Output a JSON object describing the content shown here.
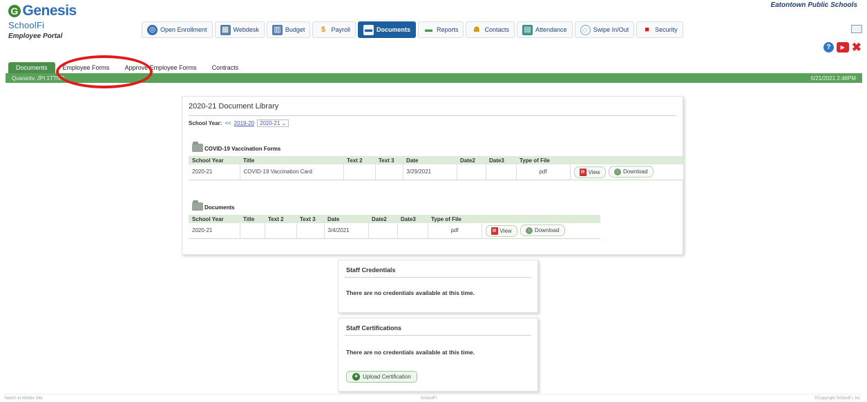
{
  "header": {
    "brand": "Genesis",
    "brand_mark": "G",
    "product": "SchoolFi",
    "portal": "Employee Portal",
    "district": "Eatontown Public Schools"
  },
  "nav": [
    {
      "label": "Open Enrollment",
      "icon": "enrollment-icon",
      "active": false
    },
    {
      "label": "Webdesk",
      "icon": "webdesk-icon",
      "active": false
    },
    {
      "label": "Budget",
      "icon": "budget-icon",
      "active": false
    },
    {
      "label": "Payroll",
      "icon": "dollar-icon",
      "active": false
    },
    {
      "label": "Documents",
      "icon": "folder-icon",
      "active": true
    },
    {
      "label": "Reports",
      "icon": "folder-icon",
      "active": false
    },
    {
      "label": "Contacts",
      "icon": "contacts-icon",
      "active": false
    },
    {
      "label": "Attendance",
      "icon": "calendar-icon",
      "active": false
    },
    {
      "label": "Swipe In/Out",
      "icon": "swipe-icon",
      "active": false
    },
    {
      "label": "Security",
      "icon": "lock-icon",
      "active": false
    }
  ],
  "tabs": [
    "Documents",
    "Employee Forms",
    "Approve Employee Forms",
    "Contracts"
  ],
  "status_bar": {
    "user": "Quarantv, JPI 1TTNG",
    "datetime": "5/21/2021 2:48PM"
  },
  "library": {
    "title": "2020-21 Document Library",
    "year_label": "School Year:",
    "year_prev_marker": "<<",
    "year_prev": "2019-20",
    "year_selected": "2020-21",
    "sections": [
      {
        "title": "COVID-19 Vaccination Forms",
        "headers": [
          "School Year",
          "Title",
          "Text 2",
          "Text 3",
          "Date",
          "Date2",
          "Date3",
          "Type of File",
          ""
        ],
        "rows": [
          {
            "school_year": "2020-21",
            "title": "COVID-19 Vaccination Card",
            "text2": "",
            "text3": "",
            "date": "3/29/2021",
            "date2": "",
            "date3": "",
            "type": "pdf"
          }
        ]
      },
      {
        "title": "Documents",
        "headers": [
          "School Year",
          "Title",
          "Text 2",
          "Text 3",
          "Date",
          "Date2",
          "Date3",
          "Type of File",
          ""
        ],
        "rows": [
          {
            "school_year": "2020-21",
            "title": "",
            "text2": "",
            "text3": "",
            "date": "3/4/2021",
            "date2": "",
            "date3": "",
            "type": "pdf"
          }
        ]
      }
    ],
    "view_label": "View",
    "download_label": "Download"
  },
  "credentials": {
    "title": "Staff Credentials",
    "message": "There are no credentials available at this time."
  },
  "certifications": {
    "title": "Staff Certifications",
    "message": "There are no credentials available at this time.",
    "upload_label": "Upload Certification"
  },
  "footer": {
    "left": "Switch to Mobile Site",
    "center": "SchoolFi",
    "right": "©Copyright SchoolFi, Inc."
  },
  "colors": {
    "nav_active": "#1d5e9e",
    "tab_bar": "#5aa15a",
    "annotation": "#e21a1a"
  }
}
